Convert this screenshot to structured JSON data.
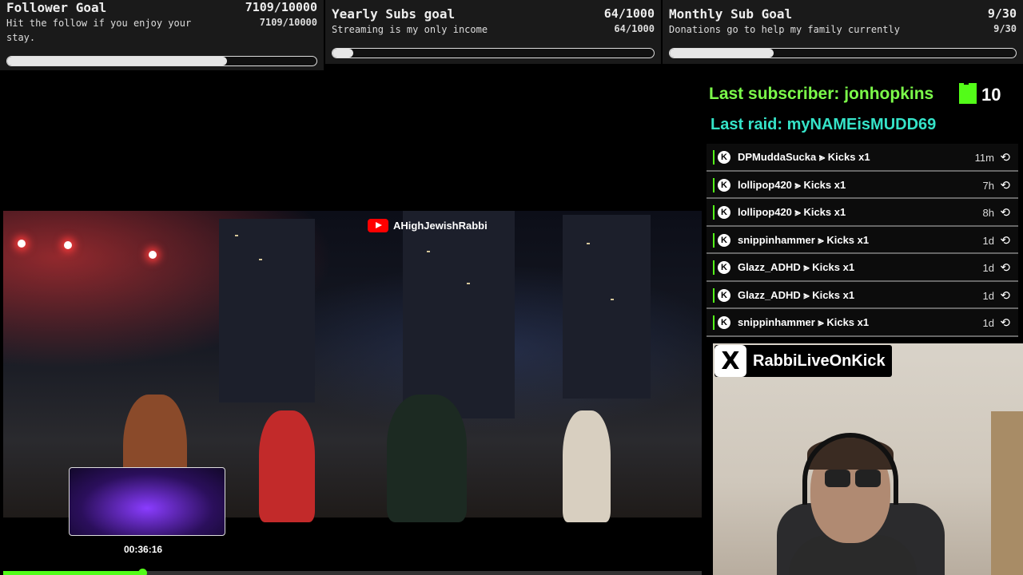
{
  "goals": [
    {
      "title": "Follower Goal",
      "count": "7109/10000",
      "subtitle": "Hit the follow if you enjoy your stay.",
      "count_small": "7109/10000",
      "progress": 0.71
    },
    {
      "title": "Yearly Subs goal",
      "count": "64/1000",
      "subtitle": "Streaming is my only income",
      "count_small": "64/1000",
      "progress": 0.064
    },
    {
      "title": "Monthly Sub Goal",
      "count": "9/30",
      "subtitle": "Donations go to help my family currently",
      "count_small": "9/30",
      "progress": 0.3
    }
  ],
  "last_subscriber": "Last subscriber: jonhopkins",
  "kick_count": "10",
  "last_raid": "Last raid: myNAMEisMUDD69",
  "events": [
    {
      "name": "DPMuddaSucka ⪢ Kicks x1",
      "time": "11m"
    },
    {
      "name": "lollipop420 ⪢ Kicks x1",
      "time": "7h"
    },
    {
      "name": "lollipop420 ⪢ Kicks x1",
      "time": "8h"
    },
    {
      "name": "snippinhammer ⪢ Kicks x1",
      "time": "1d"
    },
    {
      "name": "Glazz_ADHD ⪢ Kicks x1",
      "time": "1d"
    },
    {
      "name": "Glazz_ADHD ⪢ Kicks x1",
      "time": "1d"
    },
    {
      "name": "snippinhammer ⪢ Kicks x1",
      "time": "1d"
    }
  ],
  "event_badge": "K",
  "replay_glyph": "⟲",
  "video": {
    "watermark": "AHighJewishRabbi",
    "timestamp": "00:36:16",
    "progress": 0.2
  },
  "webcam": {
    "x_glyph": "X",
    "handle": "RabbiLiveOnKick"
  },
  "colors": {
    "kick_green": "#53fc18",
    "sub_green": "#7CFC4A",
    "raid_teal": "#35e3c8"
  }
}
